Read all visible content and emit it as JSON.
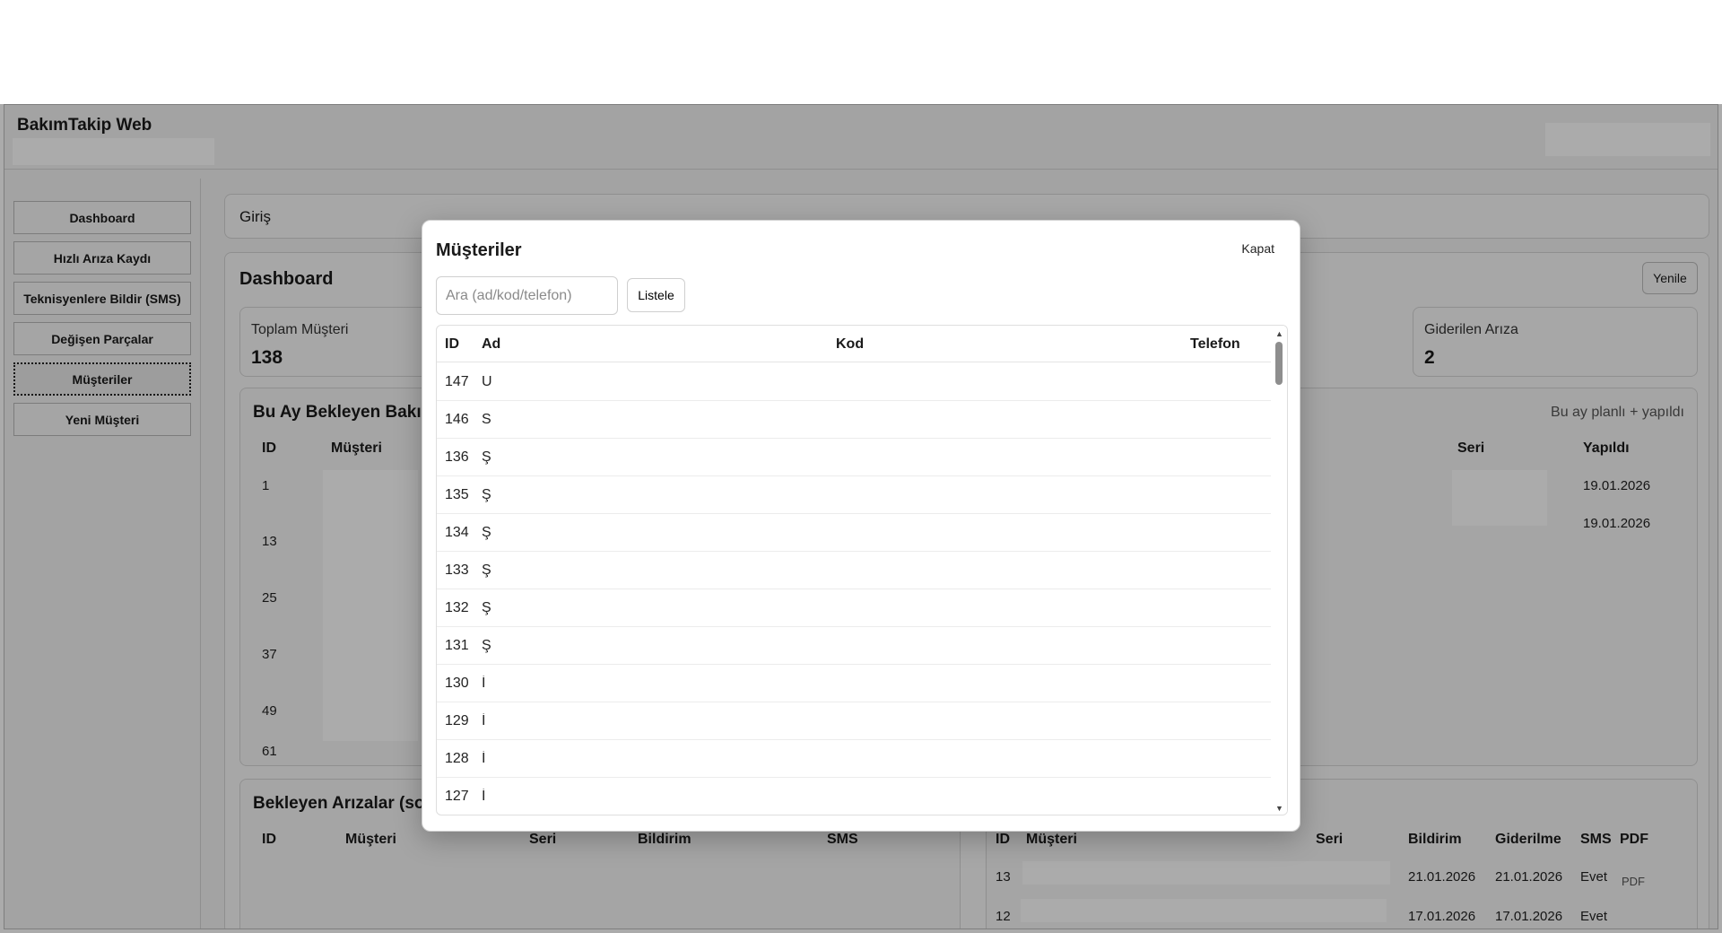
{
  "app": {
    "title": "BakımTakip Web"
  },
  "sidebar": {
    "items": [
      {
        "label": "Dashboard"
      },
      {
        "label": "Hızlı Arıza Kaydı"
      },
      {
        "label": "Teknisyenlere Bildir (SMS)"
      },
      {
        "label": "Değişen Parçalar"
      },
      {
        "label": "Müşteriler"
      },
      {
        "label": "Yeni Müşteri"
      }
    ],
    "active_index": 4
  },
  "breadcrumb": {
    "label": "Giriş"
  },
  "dashboard": {
    "title": "Dashboard",
    "refresh_label": "Yenile",
    "stats": {
      "total_customers_label": "Toplam Müşteri",
      "total_customers_value": "138",
      "fixed_faults_label": "Giderilen Arıza",
      "fixed_faults_value": "2"
    },
    "pending_maintenance": {
      "title": "Bu Ay Bekleyen Bakım",
      "right_note": "Bu ay planlı + yapıldı",
      "columns": {
        "id": "ID",
        "customer": "Müşteri",
        "serial": "Seri",
        "done": "Yapıldı"
      },
      "ids": [
        "1",
        "13",
        "25",
        "37",
        "49",
        "61"
      ],
      "done_dates": [
        "19.01.2026",
        "19.01.2026"
      ]
    },
    "pending_faults": {
      "title": "Bekleyen Arızalar (son",
      "columns": {
        "id": "ID",
        "customer": "Müşteri",
        "serial": "Seri",
        "notice": "Bildirim",
        "sms": "SMS"
      }
    },
    "recent_fixed": {
      "columns": {
        "id": "ID",
        "customer": "Müşteri",
        "serial": "Seri",
        "notice": "Bildirim",
        "fixed": "Giderilme",
        "sms": "SMS",
        "pdf": "PDF"
      },
      "rows": [
        {
          "id": "13",
          "notice": "21.01.2026",
          "fixed": "21.01.2026",
          "sms": "Evet",
          "pdf": "PDF"
        },
        {
          "id": "12",
          "notice": "17.01.2026",
          "fixed": "17.01.2026",
          "sms": "Evet"
        }
      ]
    }
  },
  "modal": {
    "title": "Müşteriler",
    "close_label": "Kapat",
    "search": {
      "placeholder": "Ara (ad/kod/telefon)",
      "value": ""
    },
    "list_button": "Listele",
    "columns": {
      "id": "ID",
      "name": "Ad",
      "code": "Kod",
      "phone": "Telefon"
    },
    "rows": [
      {
        "id": "147",
        "name": "U"
      },
      {
        "id": "146",
        "name": "S"
      },
      {
        "id": "136",
        "name": "Ş"
      },
      {
        "id": "135",
        "name": "Ş"
      },
      {
        "id": "134",
        "name": "Ş"
      },
      {
        "id": "133",
        "name": "Ş"
      },
      {
        "id": "132",
        "name": "Ş"
      },
      {
        "id": "131",
        "name": "Ş"
      },
      {
        "id": "130",
        "name": "İ"
      },
      {
        "id": "129",
        "name": "İ"
      },
      {
        "id": "128",
        "name": "İ"
      },
      {
        "id": "127",
        "name": "İ"
      }
    ]
  }
}
